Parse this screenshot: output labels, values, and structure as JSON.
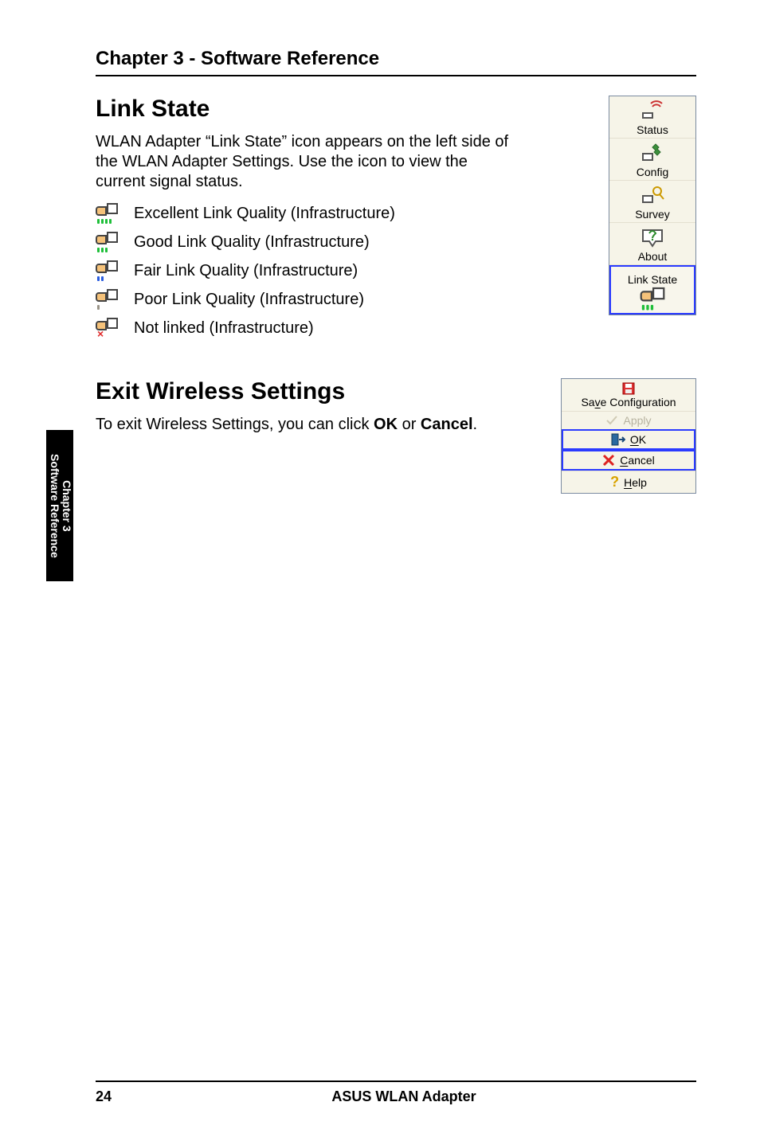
{
  "chapter_heading": "Chapter 3 - Software Reference",
  "link_state": {
    "title": "Link State",
    "intro": "WLAN Adapter “Link State” icon appears on the left side of the WLAN Adapter Settings. Use the icon to view the current signal status.",
    "items": [
      "Excellent Link Quality (Infrastructure)",
      "Good Link Quality (Infrastructure)",
      "Fair Link Quality (Infrastructure)",
      "Poor Link Quality (Infrastructure)",
      "Not linked (Infrastructure)"
    ]
  },
  "right_panel": {
    "items": [
      "Status",
      "Config",
      "Survey",
      "About",
      "Link State"
    ]
  },
  "exit": {
    "title": "Exit Wireless Settings",
    "text_pre": "To exit Wireless Settings, you can click ",
    "ok": "OK",
    "or": " or ",
    "cancel": "Cancel",
    "dot": "."
  },
  "exit_panel": {
    "save": "Save Configuration",
    "apply": "Apply",
    "ok_u": "O",
    "ok_rest": "K",
    "cancel_u": "C",
    "cancel_rest": "ancel",
    "help_u": "H",
    "help_rest": "elp"
  },
  "side_tab": {
    "line1": "Chapter 3",
    "line2": "Software Reference"
  },
  "footer": {
    "page": "24",
    "title": "ASUS WLAN Adapter"
  }
}
